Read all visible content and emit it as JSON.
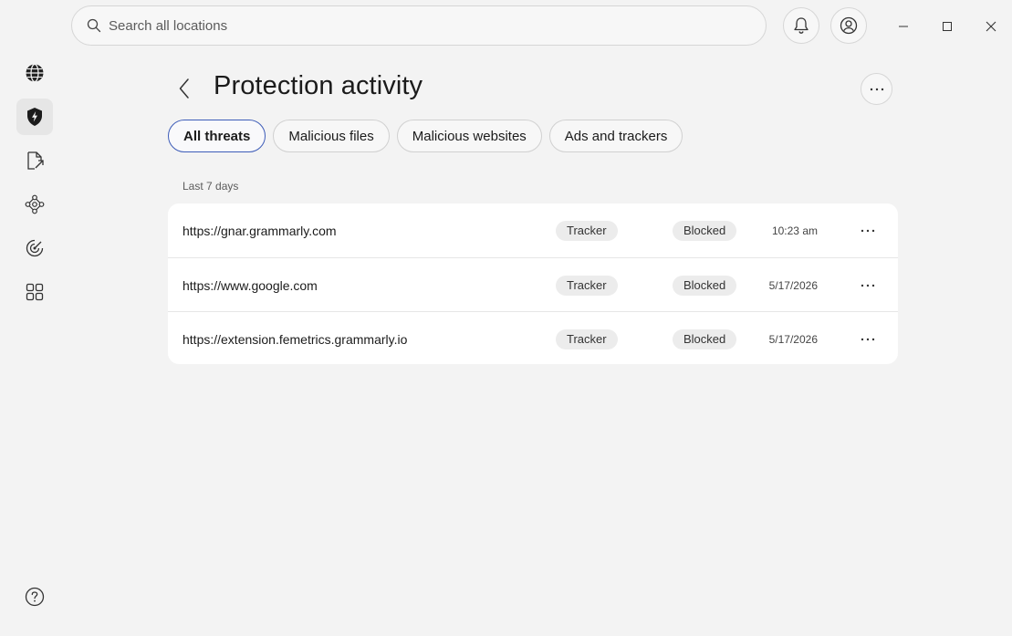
{
  "topbar": {
    "search_placeholder": "Search all locations",
    "icons": [
      "search-icon",
      "bell-icon",
      "account-icon",
      "minimize-icon",
      "maximize-icon",
      "close-icon"
    ]
  },
  "sidebar": {
    "items": [
      {
        "name": "web-protection",
        "icon": "globe-icon",
        "active": false
      },
      {
        "name": "protection",
        "icon": "shield-bolt-icon",
        "active": true
      },
      {
        "name": "file-share",
        "icon": "file-export-icon",
        "active": false
      },
      {
        "name": "network",
        "icon": "network-nodes-icon",
        "active": false
      },
      {
        "name": "tracking",
        "icon": "radar-icon",
        "active": false
      },
      {
        "name": "apps",
        "icon": "grid-icon",
        "active": false
      }
    ],
    "help_icon": "help-icon"
  },
  "page": {
    "title": "Protection activity",
    "period_label": "Last 7 days"
  },
  "tabs": [
    {
      "label": "All threats",
      "active": true
    },
    {
      "label": "Malicious files",
      "active": false
    },
    {
      "label": "Malicious websites",
      "active": false
    },
    {
      "label": "Ads and trackers",
      "active": false
    }
  ],
  "activity": [
    {
      "url": "https://gnar.grammarly.com",
      "type": "Tracker",
      "status": "Blocked",
      "time": "10:23 am"
    },
    {
      "url": "https://www.google.com",
      "type": "Tracker",
      "status": "Blocked",
      "time": "5/17/2026"
    },
    {
      "url": "https://extension.femetrics.grammarly.io",
      "type": "Tracker",
      "status": "Blocked",
      "time": "5/17/2026"
    }
  ],
  "colors": {
    "background": "#f3f3f3",
    "card": "#ffffff",
    "active_tab_border": "#3d5cb8",
    "chip": "#ececec"
  }
}
